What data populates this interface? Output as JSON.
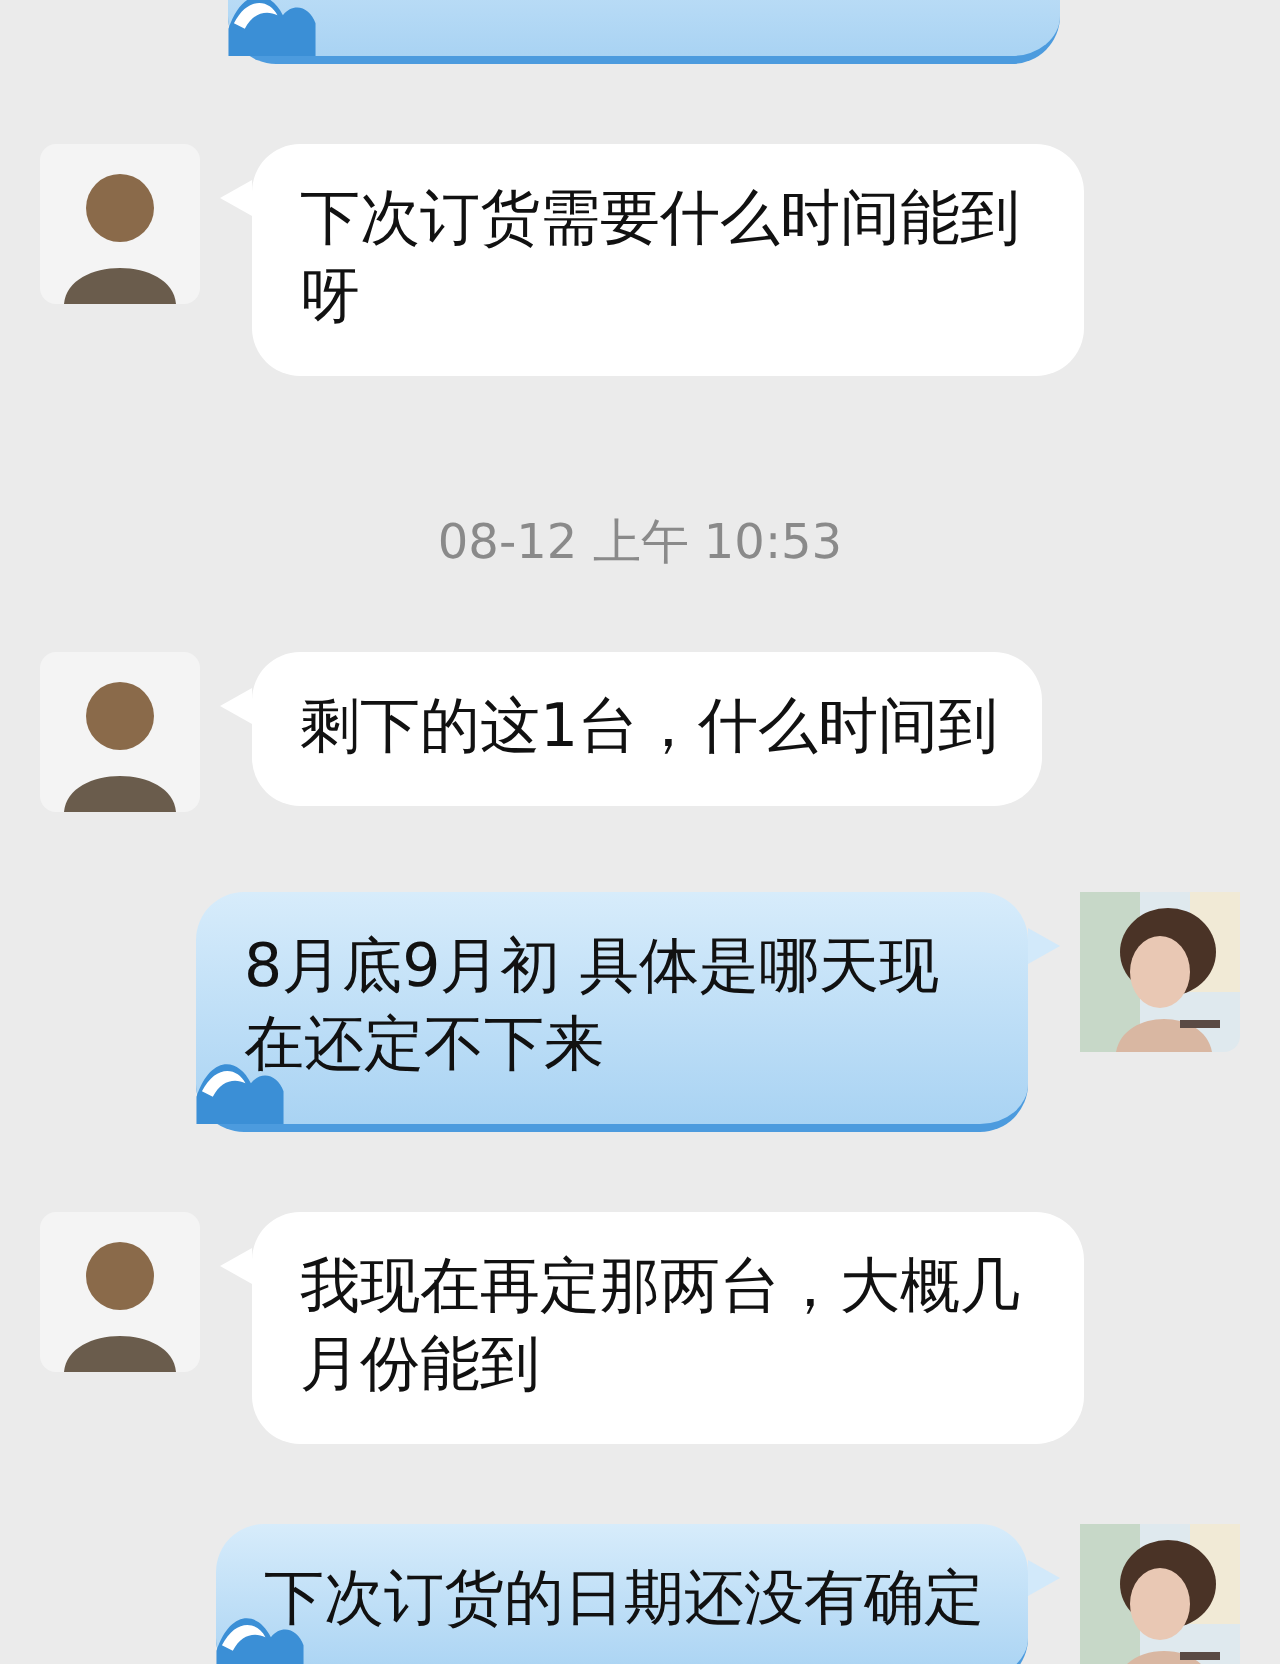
{
  "messages": [
    {
      "kind": "sent"
    },
    {
      "kind": "received",
      "text": "下次订货需要什么时间能到呀"
    },
    {
      "kind": "time",
      "text": "08-12 上午 10:53"
    },
    {
      "kind": "received",
      "text": "剩下的这1台，什么时间到"
    },
    {
      "kind": "sent",
      "text": "8月底9月初 具体是哪天现在还定不下来"
    },
    {
      "kind": "received",
      "text": "我现在再定那两台，大概几月份能到"
    },
    {
      "kind": "sent",
      "text": "下次订货的日期还没有确定"
    }
  ]
}
